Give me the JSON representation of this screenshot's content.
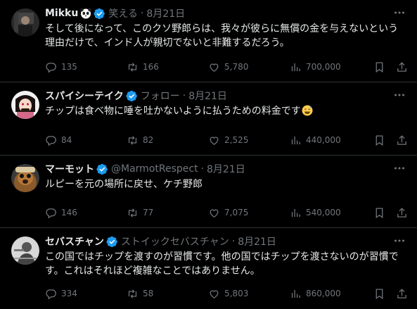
{
  "tweets": [
    {
      "name": "Mikku",
      "name_emoji": "panda-face-icon",
      "handle": "笑える",
      "time": "8月21日",
      "text": "そして後になって、このクソ野郎らは、我々が彼らに無償の金を与えないという理由だけで、インド人が親切でないと非難するだろう。",
      "replies": "135",
      "retweets": "166",
      "likes": "5,780",
      "views": "700,000"
    },
    {
      "name": "スパイシーテイク",
      "handle": "フォロー",
      "time": "8月21日",
      "text": "チップは食べ物に唾を吐かないように払うための料金です",
      "text_emoji": "sweat-smile-emoji-icon",
      "replies": "84",
      "retweets": "82",
      "likes": "2,525",
      "views": "440,000"
    },
    {
      "name": "マーモット",
      "handle": "@MarmotRespect",
      "time": "8月21日",
      "text": "ルピーを元の場所に戻せ、ケチ野郎",
      "replies": "146",
      "retweets": "77",
      "likes": "7,075",
      "views": "540,000"
    },
    {
      "name": "セバスチャン",
      "handle": "ストイックセバスチャン",
      "time": "8月21日",
      "text": "この国ではチップを渡すのが習慣です。他の国ではチップを渡さないのが習慣です。これはそれほど複雑なことではありません。",
      "replies": "334",
      "retweets": "58",
      "likes": "5,803",
      "views": "860,000"
    }
  ],
  "separator": "·",
  "colors": {
    "background": "#000000",
    "text": "#e7e9ea",
    "muted": "#71767b",
    "verified": "#1d9bf0",
    "divider": "#2f3336"
  }
}
